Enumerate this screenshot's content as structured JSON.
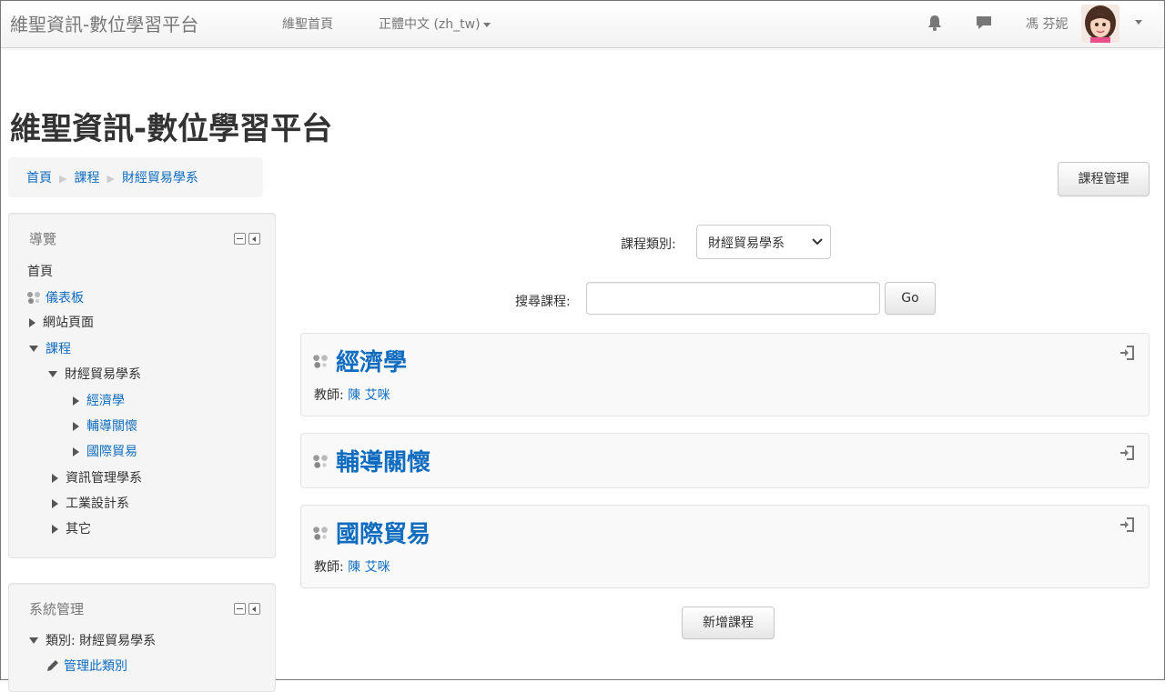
{
  "navbar": {
    "brand": "維聖資訊-數位學習平台",
    "home_link": "維聖首頁",
    "language": "正體中文 (zh_tw)",
    "username": "馮 芬妮",
    "icons": [
      "bell-icon",
      "chat-icon",
      "avatar",
      "chevron-down-icon"
    ]
  },
  "page": {
    "title": "維聖資訊-數位學習平台",
    "manage_button": "課程管理"
  },
  "breadcrumb": [
    "首頁",
    "課程",
    "財經貿易學系"
  ],
  "navigation_block": {
    "title": "導覽",
    "items": [
      {
        "label": "首頁",
        "level": 0,
        "state": "link"
      },
      {
        "label": "儀表板",
        "level": 0,
        "state": "icon-link"
      },
      {
        "label": "網站頁面",
        "level": 0,
        "state": "collapsed"
      },
      {
        "label": "課程",
        "level": 0,
        "state": "expanded"
      },
      {
        "label": "財經貿易學系",
        "level": 1,
        "state": "expanded"
      },
      {
        "label": "經濟學",
        "level": 2,
        "state": "collapsed-link"
      },
      {
        "label": "輔導關懷",
        "level": 2,
        "state": "collapsed-link"
      },
      {
        "label": "國際貿易",
        "level": 2,
        "state": "collapsed-link"
      },
      {
        "label": "資訊管理學系",
        "level": 1,
        "state": "collapsed"
      },
      {
        "label": "工業設計系",
        "level": 1,
        "state": "collapsed"
      },
      {
        "label": "其它",
        "level": 1,
        "state": "collapsed"
      }
    ]
  },
  "admin_block": {
    "title": "系統管理",
    "category_item": "類別: 財經貿易學系",
    "manage_item": "管理此類別"
  },
  "main": {
    "category_label": "課程類別:",
    "category_selected": "財經貿易學系",
    "search_label": "搜尋課程:",
    "search_value": "",
    "go_button": "Go",
    "teacher_label": "教師:",
    "courses": [
      {
        "name": "經濟學",
        "teacher": "陳 艾咪"
      },
      {
        "name": "輔導關懷",
        "teacher": ""
      },
      {
        "name": "國際貿易",
        "teacher": "陳 艾咪"
      }
    ],
    "add_course_button": "新增課程"
  },
  "colors": {
    "link": "#0f6cbf",
    "text": "#333333",
    "muted": "#777777",
    "block_bg": "#f5f5f5"
  }
}
